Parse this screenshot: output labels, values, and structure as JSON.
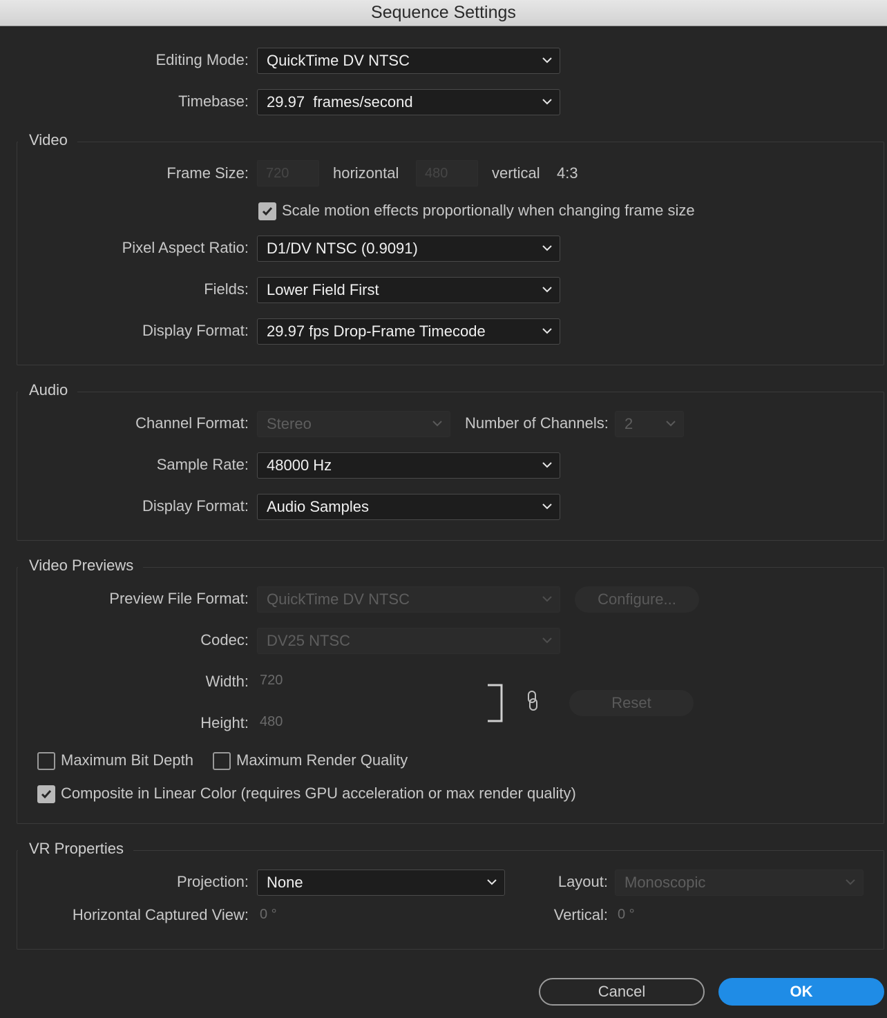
{
  "window": {
    "title": "Sequence Settings"
  },
  "top": {
    "editing_mode_label": "Editing Mode:",
    "editing_mode_value": "QuickTime DV NTSC",
    "timebase_label": "Timebase:",
    "timebase_value": "29.97  frames/second"
  },
  "video": {
    "legend": "Video",
    "frame_size_label": "Frame Size:",
    "frame_width": "720",
    "horizontal_label": "horizontal",
    "frame_height": "480",
    "vertical_label": "vertical",
    "aspect": "4:3",
    "scale_checkbox_label": "Scale motion effects proportionally when changing frame size",
    "scale_checked": true,
    "par_label": "Pixel Aspect Ratio:",
    "par_value": "D1/DV NTSC (0.9091)",
    "fields_label": "Fields:",
    "fields_value": "Lower Field First",
    "display_format_label": "Display Format:",
    "display_format_value": "29.97 fps Drop-Frame Timecode"
  },
  "audio": {
    "legend": "Audio",
    "channel_format_label": "Channel Format:",
    "channel_format_value": "Stereo",
    "num_channels_label": "Number of Channels:",
    "num_channels_value": "2",
    "sample_rate_label": "Sample Rate:",
    "sample_rate_value": "48000 Hz",
    "display_format_label": "Display Format:",
    "display_format_value": "Audio Samples"
  },
  "previews": {
    "legend": "Video Previews",
    "file_format_label": "Preview File Format:",
    "file_format_value": "QuickTime DV NTSC",
    "configure_label": "Configure...",
    "codec_label": "Codec:",
    "codec_value": "DV25 NTSC",
    "width_label": "Width:",
    "width_value": "720",
    "height_label": "Height:",
    "height_value": "480",
    "reset_label": "Reset",
    "max_bit_depth_label": "Maximum Bit Depth",
    "max_render_quality_label": "Maximum Render Quality",
    "composite_label": "Composite in Linear Color (requires GPU acceleration or max render quality)"
  },
  "vr": {
    "legend": "VR Properties",
    "projection_label": "Projection:",
    "projection_value": "None",
    "layout_label": "Layout:",
    "layout_value": "Monoscopic",
    "hview_label": "Horizontal Captured View:",
    "hview_value": "0 °",
    "vertical_label": "Vertical:",
    "vertical_value": "0 °"
  },
  "footer": {
    "cancel_label": "Cancel",
    "ok_label": "OK"
  },
  "colors": {
    "accent": "#1f8ce6",
    "background": "#262626"
  },
  "icons": [
    "chevron-down-icon",
    "checkmark-icon",
    "link-icon",
    "bracket-icon"
  ]
}
